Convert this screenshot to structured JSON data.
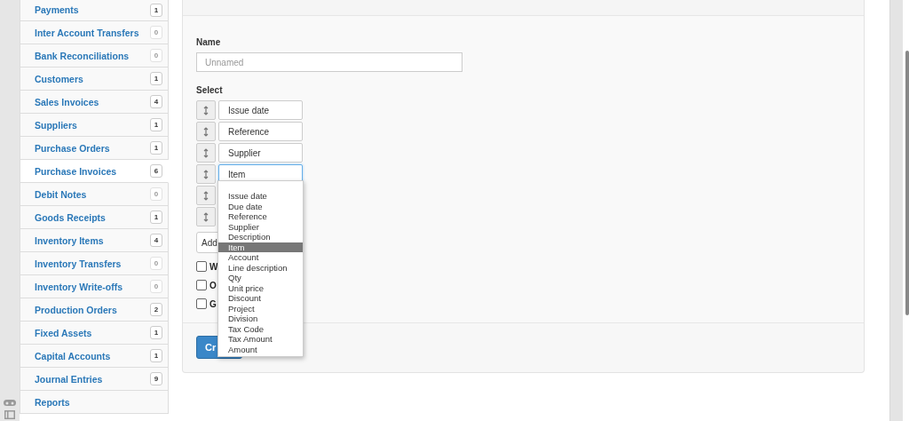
{
  "sidebar": {
    "items": [
      {
        "label": "Payments",
        "count": "1",
        "muted": false,
        "selected": false
      },
      {
        "label": "Inter Account Transfers",
        "count": "0",
        "muted": true,
        "selected": false
      },
      {
        "label": "Bank Reconciliations",
        "count": "0",
        "muted": true,
        "selected": false
      },
      {
        "label": "Customers",
        "count": "1",
        "muted": false,
        "selected": false
      },
      {
        "label": "Sales Invoices",
        "count": "4",
        "muted": false,
        "selected": false
      },
      {
        "label": "Suppliers",
        "count": "1",
        "muted": false,
        "selected": false
      },
      {
        "label": "Purchase Orders",
        "count": "1",
        "muted": false,
        "selected": false
      },
      {
        "label": "Purchase Invoices",
        "count": "6",
        "muted": false,
        "selected": true
      },
      {
        "label": "Debit Notes",
        "count": "0",
        "muted": true,
        "selected": false
      },
      {
        "label": "Goods Receipts",
        "count": "1",
        "muted": false,
        "selected": false
      },
      {
        "label": "Inventory Items",
        "count": "4",
        "muted": false,
        "selected": false
      },
      {
        "label": "Inventory Transfers",
        "count": "0",
        "muted": true,
        "selected": false
      },
      {
        "label": "Inventory Write-offs",
        "count": "0",
        "muted": true,
        "selected": false
      },
      {
        "label": "Production Orders",
        "count": "2",
        "muted": false,
        "selected": false
      },
      {
        "label": "Fixed Assets",
        "count": "1",
        "muted": false,
        "selected": false
      },
      {
        "label": "Capital Accounts",
        "count": "1",
        "muted": false,
        "selected": false
      },
      {
        "label": "Journal Entries",
        "count": "9",
        "muted": false,
        "selected": false
      },
      {
        "label": "Reports",
        "selected": false
      }
    ]
  },
  "form": {
    "name_label": "Name",
    "name_placeholder": "Unnamed",
    "select_label": "Select",
    "select_rows": [
      {
        "value": "Issue date",
        "focused": false
      },
      {
        "value": "Reference",
        "focused": false
      },
      {
        "value": "Supplier",
        "focused": false
      },
      {
        "value": "Item",
        "focused": true
      },
      {},
      {}
    ],
    "add_button": "Add",
    "checkboxes": [
      {
        "label": "W",
        "checked": false
      },
      {
        "label": "O",
        "checked": false
      },
      {
        "label": "G",
        "checked": false
      }
    ],
    "create_button": "Cr"
  },
  "dropdown": {
    "options": [
      {
        "label": "Issue date",
        "selected": false
      },
      {
        "label": "Due date",
        "selected": false
      },
      {
        "label": "Reference",
        "selected": false
      },
      {
        "label": "Supplier",
        "selected": false
      },
      {
        "label": "Description",
        "selected": false
      },
      {
        "label": "Item",
        "selected": true
      },
      {
        "label": "Account",
        "selected": false
      },
      {
        "label": "Line description",
        "selected": false
      },
      {
        "label": "Qty",
        "selected": false
      },
      {
        "label": "Unit price",
        "selected": false
      },
      {
        "label": "Discount",
        "selected": false
      },
      {
        "label": "Project",
        "selected": false
      },
      {
        "label": "Division",
        "selected": false
      },
      {
        "label": "Tax Code",
        "selected": false
      },
      {
        "label": "Tax Amount",
        "selected": false
      },
      {
        "label": "Amount",
        "selected": false
      }
    ]
  }
}
